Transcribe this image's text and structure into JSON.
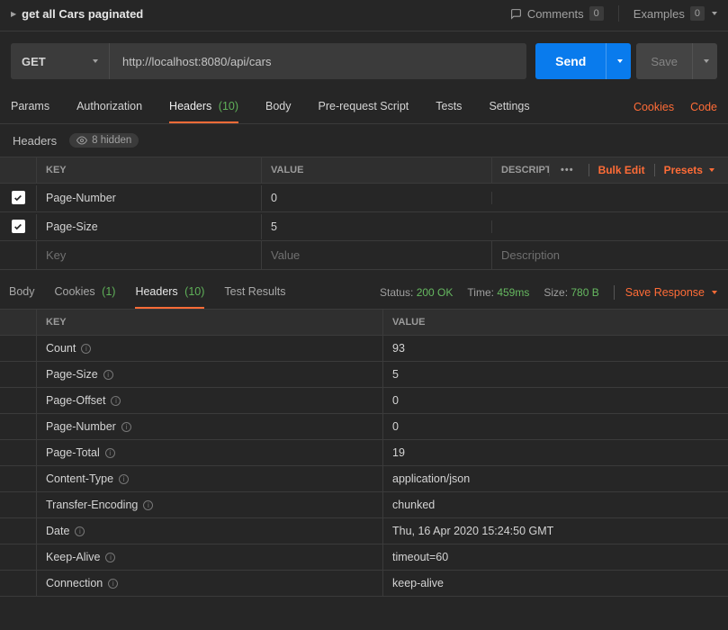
{
  "titleBar": {
    "title": "get all Cars paginated",
    "commentsLabel": "Comments",
    "commentsCount": "0",
    "examplesLabel": "Examples",
    "examplesCount": "0"
  },
  "request": {
    "method": "GET",
    "url": "http://localhost:8080/api/cars",
    "sendLabel": "Send",
    "saveLabel": "Save"
  },
  "reqTabs": {
    "params": "Params",
    "authorization": "Authorization",
    "headers": "Headers",
    "headersCount": "(10)",
    "body": "Body",
    "prerequest": "Pre-request Script",
    "tests": "Tests",
    "settings": "Settings",
    "cookiesLink": "Cookies",
    "codeLink": "Code"
  },
  "headersSub": {
    "label": "Headers",
    "hiddenText": "8 hidden"
  },
  "reqHeadersTable": {
    "colKey": "KEY",
    "colValue": "VALUE",
    "colDesc": "DESCRIPTIO",
    "bulkEdit": "Bulk Edit",
    "presets": "Presets",
    "rows": [
      {
        "key": "Page-Number",
        "value": "0"
      },
      {
        "key": "Page-Size",
        "value": "5"
      }
    ],
    "placeholderKey": "Key",
    "placeholderValue": "Value",
    "placeholderDesc": "Description"
  },
  "respTabs": {
    "body": "Body",
    "cookies": "Cookies",
    "cookiesCount": "(1)",
    "headers": "Headers",
    "headersCount": "(10)",
    "testResults": "Test Results"
  },
  "respMeta": {
    "statusLabel": "Status:",
    "statusValue": "200 OK",
    "timeLabel": "Time:",
    "timeValue": "459ms",
    "sizeLabel": "Size:",
    "sizeValue": "780 B",
    "saveResponse": "Save Response"
  },
  "respHeadersTable": {
    "colKey": "KEY",
    "colValue": "VALUE",
    "rows": [
      {
        "key": "Count",
        "value": "93"
      },
      {
        "key": "Page-Size",
        "value": "5"
      },
      {
        "key": "Page-Offset",
        "value": "0"
      },
      {
        "key": "Page-Number",
        "value": "0"
      },
      {
        "key": "Page-Total",
        "value": "19"
      },
      {
        "key": "Content-Type",
        "value": "application/json"
      },
      {
        "key": "Transfer-Encoding",
        "value": "chunked"
      },
      {
        "key": "Date",
        "value": "Thu, 16 Apr 2020 15:24:50 GMT"
      },
      {
        "key": "Keep-Alive",
        "value": "timeout=60"
      },
      {
        "key": "Connection",
        "value": "keep-alive"
      }
    ]
  }
}
